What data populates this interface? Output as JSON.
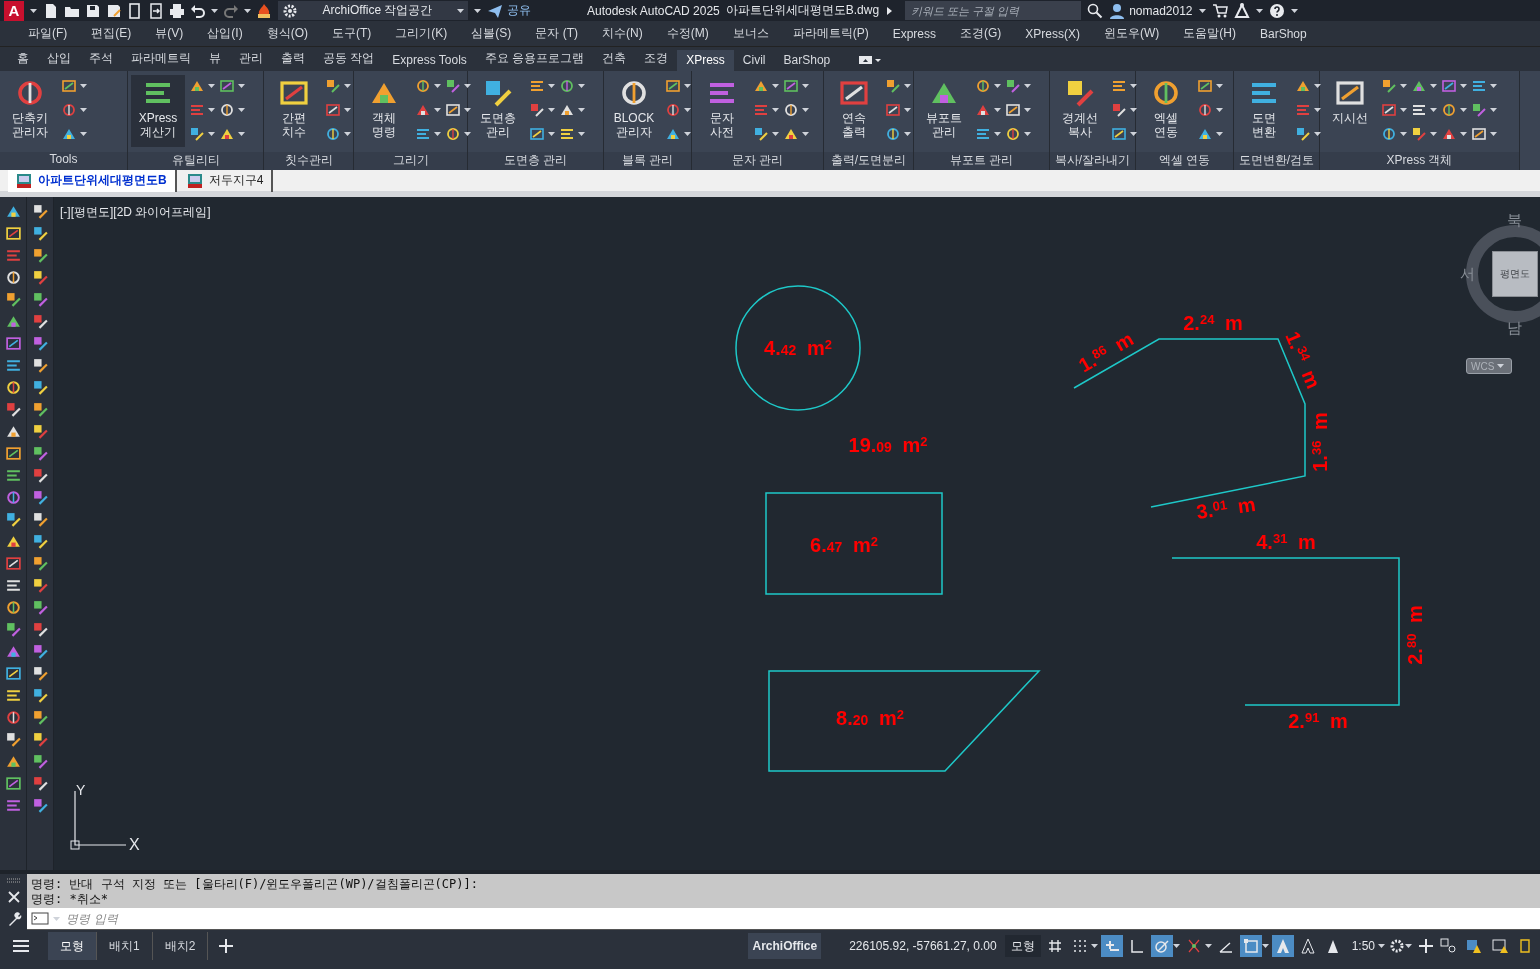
{
  "title_bar": {
    "app_logo": "A",
    "workspace": "ArchiOffice 작업공간",
    "share": "공유",
    "app_title": "Autodesk AutoCAD 2025",
    "file_name": "아파트단위세대평면도B.dwg",
    "search": {
      "placeholder": "키워드 또는 구절 입력"
    },
    "user": "nomad2012"
  },
  "menu_bar": [
    "파일(F)",
    "편집(E)",
    "뷰(V)",
    "삽입(I)",
    "형식(O)",
    "도구(T)",
    "그리기(K)",
    "심볼(S)",
    "문자 (T)",
    "치수(N)",
    "수정(M)",
    "보너스",
    "파라메트릭(P)",
    "Express",
    "조경(G)",
    "XPress(X)",
    "윈도우(W)",
    "도움말(H)",
    "BarShop"
  ],
  "ribbon_tabs": [
    {
      "label": "홈",
      "selected": false
    },
    {
      "label": "삽입",
      "selected": false
    },
    {
      "label": "주석",
      "selected": false
    },
    {
      "label": "파라메트릭",
      "selected": false
    },
    {
      "label": "뷰",
      "selected": false
    },
    {
      "label": "관리",
      "selected": false
    },
    {
      "label": "출력",
      "selected": false
    },
    {
      "label": "공동 작업",
      "selected": false
    },
    {
      "label": "Express Tools",
      "selected": false
    },
    {
      "label": "주요 응용프로그램",
      "selected": false
    },
    {
      "label": "건축",
      "selected": false
    },
    {
      "label": "조경",
      "selected": false
    },
    {
      "label": "XPress",
      "selected": true
    },
    {
      "label": "Civil",
      "selected": false
    },
    {
      "label": "BarShop",
      "selected": false
    }
  ],
  "ribbon_panels": [
    {
      "title": "Tools",
      "big_button": {
        "label": "단축키\n관리자",
        "highlighted": false
      }
    },
    {
      "title": "유틸리티",
      "big_button": {
        "label": "XPress\n계산기",
        "highlighted": true
      }
    },
    {
      "title": "칫수관리",
      "big_button": {
        "label": "간편\n치수",
        "highlighted": false
      }
    },
    {
      "title": "그리기",
      "big_button": {
        "label": "객체\n명령",
        "highlighted": false
      }
    },
    {
      "title": "도면층 관리",
      "big_button": {
        "label": "도면층\n관리",
        "highlighted": false
      }
    },
    {
      "title": "블록 관리",
      "big_button": {
        "label": "BLOCK\n관리자",
        "highlighted": false
      }
    },
    {
      "title": "문자 관리",
      "big_button": {
        "label": "문자\n사전",
        "highlighted": false
      }
    },
    {
      "title": "출력/도면분리",
      "big_button": {
        "label": "연속\n출력",
        "highlighted": false
      }
    },
    {
      "title": "뷰포트 관리",
      "big_button": {
        "label": "뷰포트\n관리",
        "highlighted": false
      }
    },
    {
      "title": "복사/잘라내기",
      "big_button": {
        "label": "경계선\n복사",
        "highlighted": false
      }
    },
    {
      "title": "엑셀 연동",
      "big_button": {
        "label": "엑셀\n연동",
        "highlighted": false
      }
    },
    {
      "title": "도면변환/검토",
      "big_button": {
        "label": "도면\n변환",
        "highlighted": false
      }
    },
    {
      "title": "XPress 객체",
      "big_button": {
        "label": "지시선",
        "highlighted": false
      }
    }
  ],
  "file_tabs": [
    {
      "label": "아파트단위세대평면도B",
      "selected": true
    },
    {
      "label": "저두지구4",
      "selected": false
    }
  ],
  "viewport_label": "[-][평면도][2D 와이어프레임]",
  "drawing": {
    "area_labels": [
      "4.$_{42}$ m$^{2}$",
      "19.$_{09}$ m$^{2}$",
      "6.$_{47}$ m$^{2}$",
      "8.$_{20}$ m$^{2}$"
    ],
    "length_labels": [
      "1.$^{86}$ m",
      "2.$^{24}$ m",
      "1.$^{34}$ m",
      "1.$^{36}$ m",
      "3.$^{01}$ m",
      "4.$^{31}$ m",
      "2.$^{80}$ m",
      "2.$^{91}$ m"
    ]
  },
  "view_cube": {
    "north": "북",
    "west": "서",
    "south": "남",
    "face": "평면도",
    "coordinate_system": "WCS"
  },
  "ucs_icon": {
    "y_label": "Y",
    "x_label": "X"
  },
  "command_window": {
    "history": [
      "명령: 반대 구석 지정 또는 [울타리(F)/윈도우폴리곤(WP)/걸침폴리곤(CP)]:",
      "명령: *취소*"
    ],
    "input": {
      "placeholder": "명령 입력"
    }
  },
  "status_bar": {
    "layout_tabs": [
      {
        "label": "모형",
        "selected": true
      },
      {
        "label": "배치1",
        "selected": false
      },
      {
        "label": "배치2",
        "selected": false
      }
    ],
    "workspace": "ArchiOffice",
    "coordinates": "226105.92, -57661.27, 0.00",
    "space": "모형",
    "toggles": [
      {
        "selected": false
      },
      {
        "selected": false
      },
      {
        "selected": true
      },
      {
        "selected": false
      },
      {
        "selected": true
      },
      {
        "selected": false
      },
      {
        "selected": false
      },
      {
        "selected": true
      },
      {
        "selected": true
      },
      {
        "selected": false
      },
      {
        "selected": false
      }
    ],
    "scale": "1:50"
  }
}
